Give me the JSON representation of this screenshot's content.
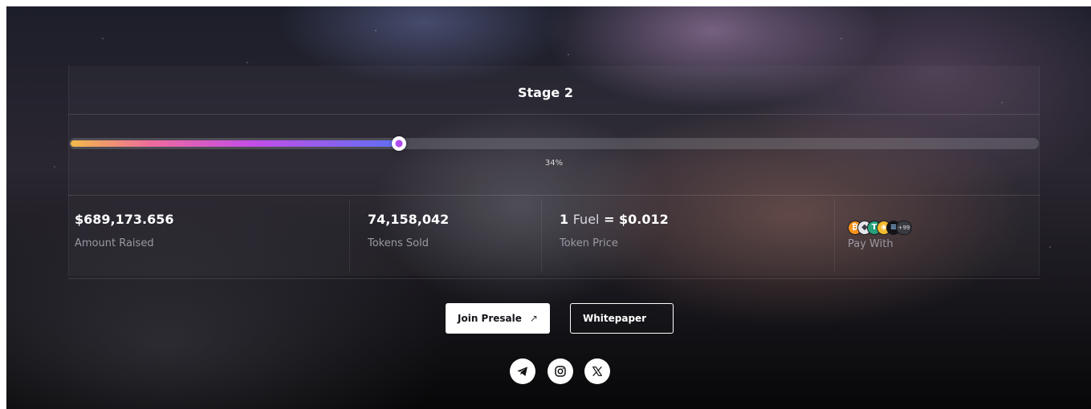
{
  "stage": {
    "title": "Stage 2"
  },
  "progress": {
    "percent": 34,
    "label": "34%"
  },
  "stats": [
    {
      "value": "$689,173.656",
      "label": "Amount Raised"
    },
    {
      "value": "74,158,042",
      "label": "Tokens Sold"
    },
    {
      "value_prefix": "1",
      "value_unit": "Fuel",
      "value_suffix": "= $0.012",
      "label": "Token Price"
    },
    {
      "label": "Pay With",
      "more_count": "+99",
      "coins": [
        "btc-icon",
        "eth-icon",
        "usdt-icon",
        "bnb-icon",
        "sol-icon"
      ]
    }
  ],
  "buttons": {
    "join": "Join Presale",
    "whitepaper": "Whitepaper"
  },
  "social": [
    "telegram-icon",
    "instagram-icon",
    "x-icon"
  ],
  "colors": {
    "progress_gradient": [
      "#f2b94a",
      "#ee6a9e",
      "#c44de8",
      "#5f6ff2"
    ],
    "thumb": "#b24cf0",
    "label_muted": "#9a9aa4"
  }
}
